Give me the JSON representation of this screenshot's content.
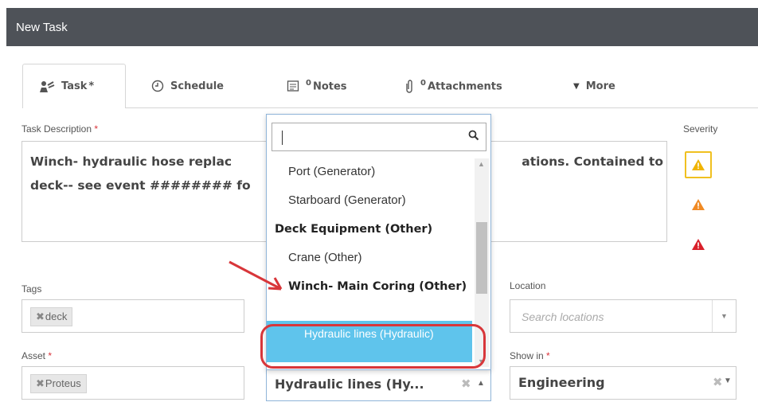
{
  "window": {
    "title": "New Task"
  },
  "tabs": [
    {
      "label": "Task",
      "marker": "*",
      "icon": "task-icon"
    },
    {
      "label": "Schedule",
      "icon": "clock-icon"
    },
    {
      "label": "Notes",
      "count": "0",
      "icon": "notes-icon"
    },
    {
      "label": "Attachments",
      "count": "0",
      "icon": "paperclip-icon"
    },
    {
      "label": "More",
      "icon": "caret-down-icon"
    }
  ],
  "task_description": {
    "label": "Task Description",
    "required_marker": "*",
    "line1_start": "Winch- hydraulic hose replac",
    "line1_end": "ations.  Contained to",
    "line2": "deck-- see event ######## fo"
  },
  "severity": {
    "label": "Severity",
    "levels": [
      {
        "name": "low",
        "color": "#f0b400",
        "selected": true
      },
      {
        "name": "medium",
        "color": "#f08a24",
        "selected": false
      },
      {
        "name": "high",
        "color": "#d9202a",
        "selected": false
      }
    ]
  },
  "tags": {
    "label": "Tags",
    "chips": [
      "deck"
    ],
    "chip_remove": "✖"
  },
  "asset": {
    "label": "Asset",
    "required_marker": "*",
    "chips": [
      "Proteus"
    ],
    "chip_remove": "✖"
  },
  "location": {
    "label": "Location",
    "placeholder": "Search locations"
  },
  "show_in": {
    "label": "Show in",
    "required_marker": "*",
    "value": "Engineering"
  },
  "component_select": {
    "value": "Hydraulic lines (Hy..."
  },
  "dropdown": {
    "search_value": "",
    "options": [
      {
        "label": "Port (Generator)",
        "type": "option"
      },
      {
        "label": "Starboard (Generator)",
        "type": "option"
      },
      {
        "label": "Deck Equipment (Other)",
        "type": "group"
      },
      {
        "label": "Crane (Other)",
        "type": "option"
      },
      {
        "label": "Winch- Main Coring (Other)",
        "type": "subgroup"
      },
      {
        "label": "Hydraulic lines (Hydraulic)",
        "type": "highlighted"
      }
    ]
  },
  "colors": {
    "accent": "#5fc4ec",
    "annotation": "#d8363a",
    "titlebar": "#4e5258"
  }
}
